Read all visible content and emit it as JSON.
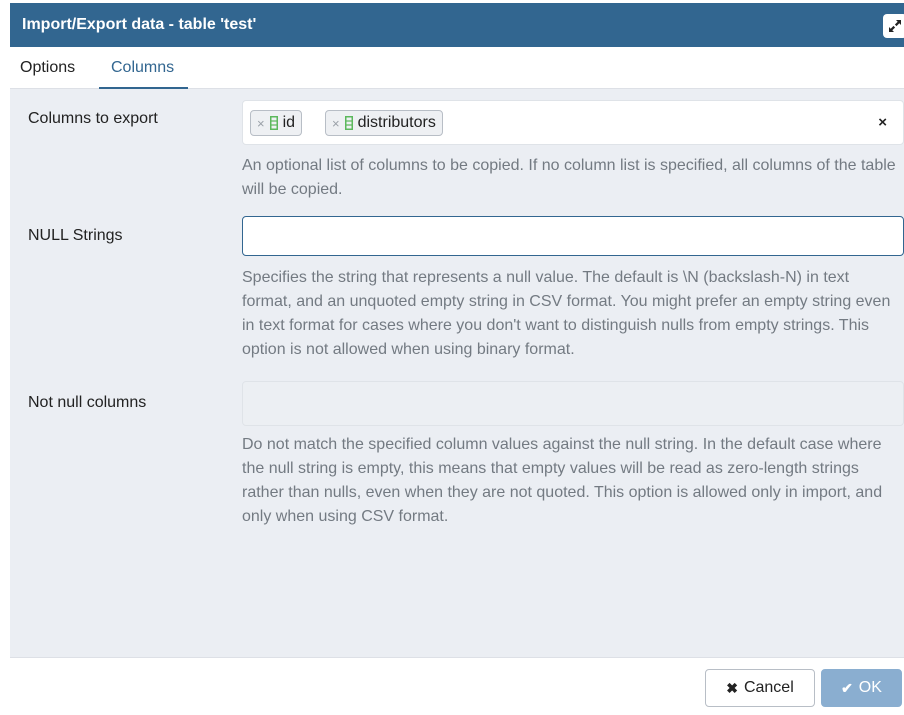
{
  "dialog": {
    "title": "Import/Export data - table 'test'",
    "maximize_icon": "expand-arrows-icon"
  },
  "tabs": [
    {
      "label": "Options",
      "active": false
    },
    {
      "label": "Columns",
      "active": true
    }
  ],
  "columns_to_export": {
    "label": "Columns to export",
    "chips": [
      {
        "remove": "×",
        "icon": "column-icon",
        "label": "id"
      },
      {
        "remove": "×",
        "icon": "column-icon",
        "label": "distributors"
      }
    ],
    "clear_all": "×",
    "help": "An optional list of columns to be copied. If no column list is specified, all columns of the table will be copied."
  },
  "null_strings": {
    "label": "NULL Strings",
    "value": "",
    "help": "Specifies the string that represents a null value. The default is \\N (backslash-N) in text format, and an unquoted empty string in CSV format. You might prefer an empty string even in text format for cases where you don't want to distinguish nulls from empty strings. This option is not allowed when using binary format."
  },
  "not_null_columns": {
    "label": "Not null columns",
    "help": "Do not match the specified column values against the null string. In the default case where the null string is empty, this means that empty values will be read as zero-length strings rather than nulls, even when they are not quoted. This option is allowed only in import, and only when using CSV format."
  },
  "footer": {
    "cancel_icon": "✖",
    "cancel_label": "Cancel",
    "ok_icon": "✔",
    "ok_label": "OK"
  },
  "colors": {
    "title_bar": "#326690",
    "accent": "#326690",
    "content_bg": "#ebeef3",
    "ok_disabled": "#8aaed0",
    "help_text": "#737a82"
  }
}
